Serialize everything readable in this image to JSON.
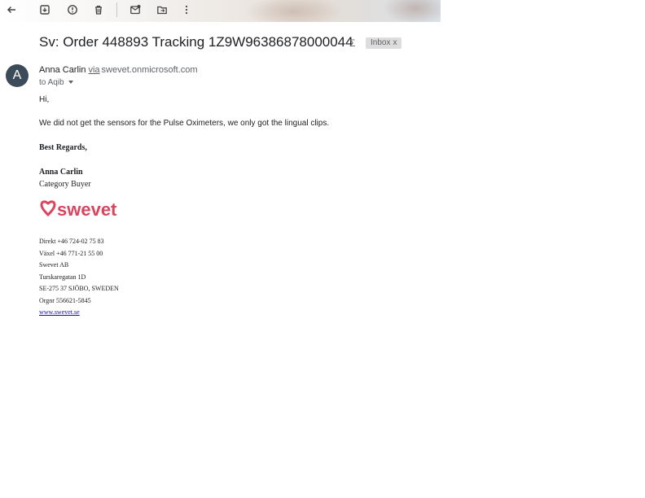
{
  "email": {
    "subject": "Sv: Order 448893 Tracking 1Z9W96386878000044",
    "label": "Inbox",
    "label_remove": "x",
    "sender": {
      "initial": "A",
      "name": "Anna Carlin",
      "via": "via",
      "domain": "swevet.onmicrosoft.com"
    },
    "to_line": "to Aqib",
    "greeting": "Hi,",
    "message": "We did not get the sensors for the Pulse Oximeters, we only got the lingual clips.",
    "closing": "Best Regards,",
    "signature": {
      "name": "Anna Carlin",
      "title": "Category Buyer",
      "logo_text": "swevet",
      "direct": "Direkt +46 724-02 75 83",
      "vaxel": "Växel +46 771-21 55 00",
      "company": "Swevet AB",
      "street": "Turskaregatan 1D",
      "city": "SE-275 37 SJÖBO, SWEDEN",
      "org": "Orgnr 556621-5845",
      "website": "www.swevet.se"
    }
  },
  "toolbar": {
    "icons": [
      "back-arrow-icon",
      "archive-icon",
      "report-spam-icon",
      "delete-icon",
      "mark-unread-icon",
      "move-to-icon",
      "more-options-icon"
    ]
  },
  "colors": {
    "brand": "#d9445e",
    "avatar_bg": "#3c4b5a",
    "label_chip": "#dddddd"
  }
}
